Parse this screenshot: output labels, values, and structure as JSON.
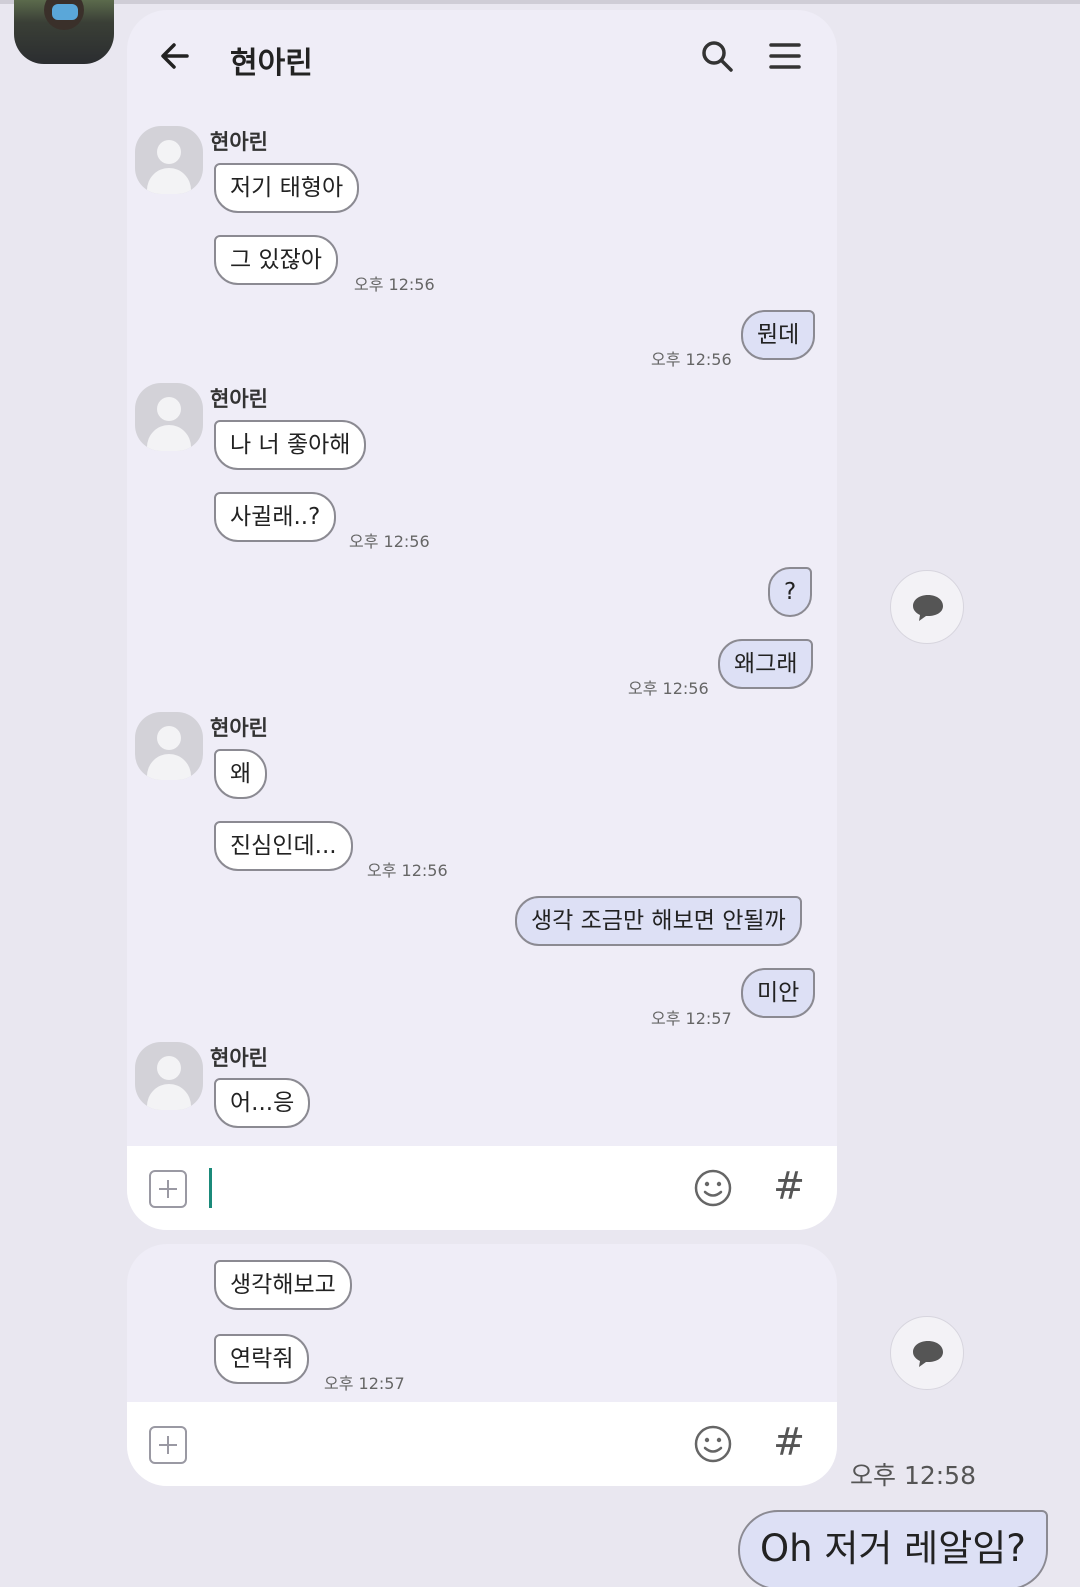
{
  "chat": {
    "title": "현아린",
    "sender": "현아린",
    "messages": [
      {
        "text": "저기 태형아"
      },
      {
        "text": "그 있잖아",
        "time": "오후 12:56"
      },
      {
        "text": "뭔데",
        "time": "오후 12:56"
      },
      {
        "text": "나 너 좋아해"
      },
      {
        "text": "사귈래..?",
        "time": "오후 12:56"
      },
      {
        "text": "?"
      },
      {
        "text": "왜그래",
        "time": "오후 12:56"
      },
      {
        "text": "왜"
      },
      {
        "text": "진심인데...",
        "time": "오후 12:56"
      },
      {
        "text": "생각 조금만 해보면 안될까"
      },
      {
        "text": "미안",
        "time": "오후 12:57"
      },
      {
        "text": "어...응"
      }
    ]
  },
  "chat2": {
    "messages": [
      {
        "text": "생각해보고"
      },
      {
        "text": "연락줘",
        "time": "오후 12:57"
      }
    ]
  },
  "input": {
    "hash": "#"
  },
  "outer": {
    "time": "오후 12:58",
    "message": "Oh 저거 레알임?"
  },
  "icons": {
    "back": "arrow-left-icon",
    "search": "search-icon",
    "menu": "hamburger-menu-icon",
    "attach": "plus-icon",
    "emoji": "smiley-icon",
    "bubble": "speech-bubble-icon"
  },
  "colors": {
    "background": "#e9e7f0",
    "chat_background": "#efedf7",
    "incoming_bubble": "#ffffff",
    "outgoing_bubble": "#dde0f5",
    "caret": "#1b8a7a"
  }
}
